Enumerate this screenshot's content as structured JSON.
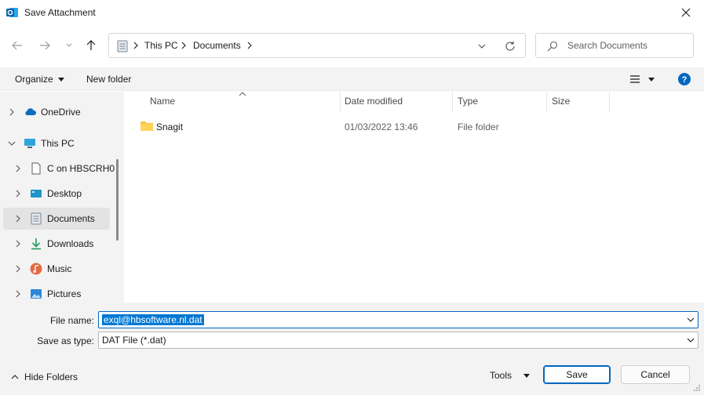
{
  "window": {
    "title": "Save Attachment"
  },
  "address": {
    "segments": [
      "This PC",
      "Documents"
    ]
  },
  "search": {
    "placeholder": "Search Documents"
  },
  "toolbar": {
    "organize_label": "Organize",
    "new_folder_label": "New folder"
  },
  "nav": {
    "items": [
      {
        "label": "OneDrive",
        "icon": "cloud-icon",
        "expanded": false
      },
      {
        "label": "This PC",
        "icon": "computer-icon",
        "expanded": true
      },
      {
        "label": "C on HBSCRH0",
        "icon": "drive-icon",
        "expanded": false
      },
      {
        "label": "Desktop",
        "icon": "desktop-icon",
        "expanded": false
      },
      {
        "label": "Documents",
        "icon": "documents-icon",
        "expanded": false,
        "selected": true
      },
      {
        "label": "Downloads",
        "icon": "download-icon",
        "expanded": false
      },
      {
        "label": "Music",
        "icon": "music-icon",
        "expanded": false
      },
      {
        "label": "Pictures",
        "icon": "pictures-icon",
        "expanded": false
      }
    ]
  },
  "files": {
    "columns": [
      "Name",
      "Date modified",
      "Type",
      "Size"
    ],
    "rows": [
      {
        "name": "Snagit",
        "date": "01/03/2022 13:46",
        "type": "File folder",
        "size": ""
      }
    ]
  },
  "form": {
    "filename_label": "File name:",
    "filename_value": "exql@hbsoftware.nl.dat",
    "savetype_label": "Save as type:",
    "savetype_value": "DAT File (*.dat)"
  },
  "footer": {
    "hide_folders_label": "Hide Folders",
    "tools_label": "Tools",
    "save_label": "Save",
    "cancel_label": "Cancel"
  },
  "colors": {
    "accent": "#0067c0",
    "folder": "#f8c544",
    "selection": "#0078d4"
  }
}
